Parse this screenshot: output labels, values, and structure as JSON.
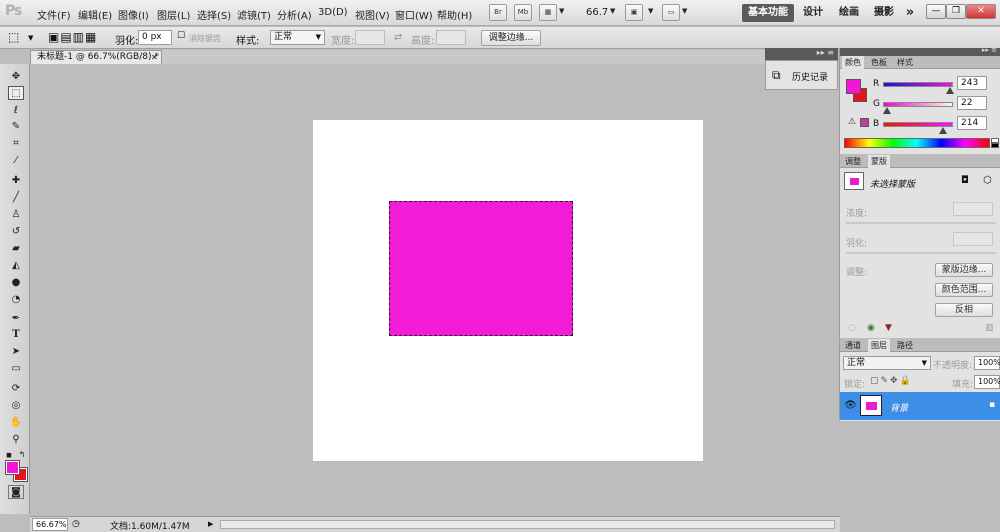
{
  "app": {
    "logo": "Ps"
  },
  "menu": [
    "文件(F)",
    "编辑(E)",
    "图像(I)",
    "图层(L)",
    "选择(S)",
    "滤镜(T)",
    "分析(A)",
    "3D(D)",
    "视图(V)",
    "窗口(W)",
    "帮助(H)"
  ],
  "menubar_tools": {
    "bridge": "Br",
    "minibridge": "Mb",
    "zoom": "66.7"
  },
  "workspaces": {
    "essentials": "基本功能",
    "design": "设计",
    "painting": "绘画",
    "photography": "摄影",
    "more": "»"
  },
  "window_controls": {
    "minimize": "—",
    "restore": "❐",
    "close": "✕"
  },
  "options": {
    "feather_label": "羽化:",
    "feather_value": "0 px",
    "antialias_label": "消除锯齿",
    "style_label": "样式:",
    "style_value": "正常",
    "width_label": "宽度:",
    "height_label": "高度:",
    "refine_edge": "调整边缘..."
  },
  "document": {
    "tab_title": "未标题-1 @ 66.7%(RGB/8) *",
    "close": "✕"
  },
  "colors": {
    "foreground": "#f316d6",
    "background": "#e8121c",
    "fill": "#f21bd8",
    "canvas_bg": "#bdbdbd"
  },
  "status": {
    "zoom": "66.67%",
    "doc_info": "文档:1.60M/1.47M"
  },
  "history": {
    "label": "历史记录"
  },
  "color_panel": {
    "tabs": [
      "颜色",
      "色板",
      "样式"
    ],
    "r_label": "R",
    "g_label": "G",
    "b_label": "B",
    "r_value": "243",
    "g_value": "22",
    "b_value": "214"
  },
  "adjust_panel": {
    "tabs": [
      "调整",
      "蒙版"
    ],
    "mask_title": "未选择蒙版",
    "density_label": "浓度:",
    "feather_label": "羽化:",
    "refine_label": "调整:",
    "mask_edge": "蒙版边缘...",
    "color_range": "颜色范围...",
    "invert": "反相"
  },
  "layers_panel": {
    "tabs": [
      "通道",
      "图层",
      "路径"
    ],
    "blend_mode": "正常",
    "opacity_label": "不透明度:",
    "opacity_value": "100%",
    "lock_label": "锁定:",
    "fill_label": "填充:",
    "fill_value": "100%",
    "layer_name": "背景"
  }
}
